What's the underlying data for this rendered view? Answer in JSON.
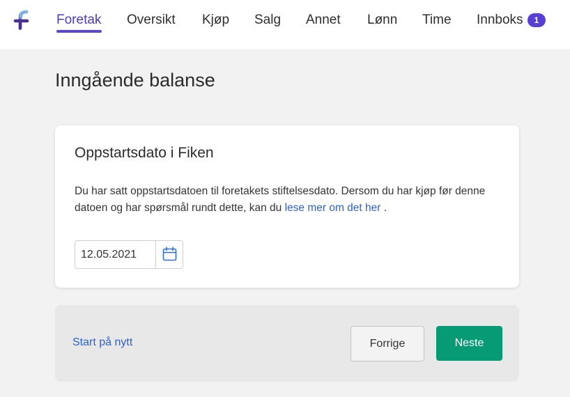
{
  "nav": {
    "logo_icon": "fiken-logo-icon",
    "items": [
      {
        "label": "Foretak",
        "active": true
      },
      {
        "label": "Oversikt"
      },
      {
        "label": "Kjøp"
      },
      {
        "label": "Salg"
      },
      {
        "label": "Annet"
      },
      {
        "label": "Lønn"
      },
      {
        "label": "Time"
      },
      {
        "label": "Innboks"
      }
    ],
    "inbox_badge": "1"
  },
  "page": {
    "title": "Inngående balanse"
  },
  "card": {
    "title": "Oppstartsdato i Fiken",
    "text_before": "Du har satt oppstartsdatoen til foretakets stiftelsesdato. Dersom du har kjøp før denne datoen og har spørsmål rundt dette, kan du ",
    "link": "lese mer om det her",
    "text_after": " .",
    "date_value": "12.05.2021",
    "calendar_icon": "calendar-icon"
  },
  "footer": {
    "restart_label": "Start på nytt",
    "prev_label": "Forrige",
    "next_label": "Neste"
  },
  "colors": {
    "accent": "#5b44d6",
    "link": "#2f5fd0",
    "primary_button": "#079b75",
    "background": "#f2f2f2"
  }
}
